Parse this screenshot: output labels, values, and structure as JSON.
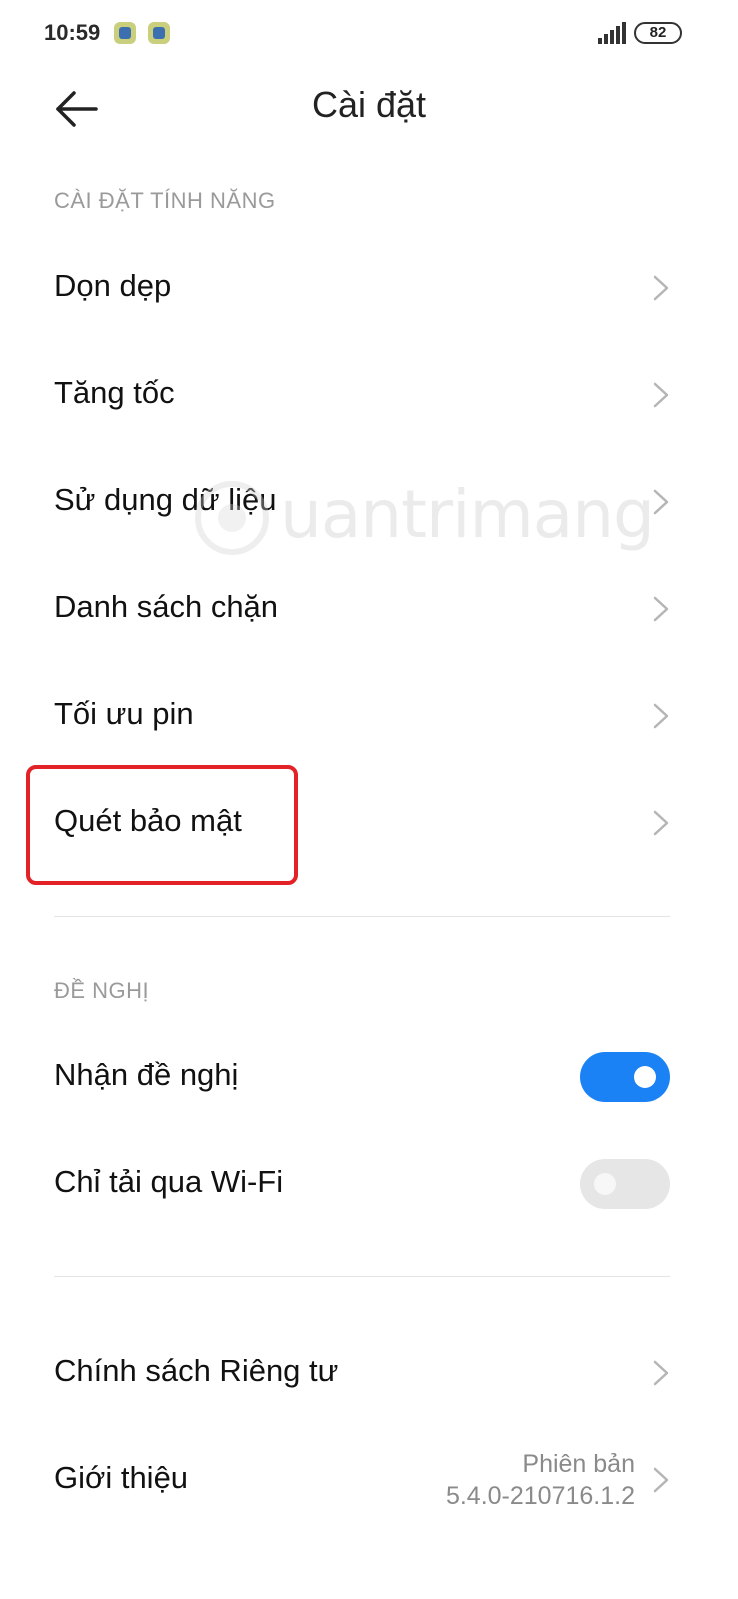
{
  "status": {
    "time": "10:59",
    "battery": "82",
    "icons": [
      "notification-app-icon",
      "notification-app-icon",
      "signal-icon",
      "battery-icon"
    ]
  },
  "header": {
    "title": "Cài đặt",
    "back_icon": "arrow-left-icon"
  },
  "sections": {
    "features": {
      "title": "CÀI ĐẶT TÍNH NĂNG",
      "items": [
        {
          "label": "Dọn dẹp"
        },
        {
          "label": "Tăng tốc"
        },
        {
          "label": "Sử dụng dữ liệu"
        },
        {
          "label": "Danh sách chặn"
        },
        {
          "label": "Tối ưu pin"
        },
        {
          "label": "Quét bảo mật"
        }
      ]
    },
    "suggestions": {
      "title": "ĐỀ NGHỊ",
      "toggles": [
        {
          "label": "Nhận đề nghị",
          "on": true
        },
        {
          "label": "Chỉ tải qua Wi-Fi",
          "on": false
        }
      ]
    },
    "about": {
      "items": [
        {
          "label": "Chính sách Riêng tư"
        },
        {
          "label": "Giới thiệu",
          "version_line1": "Phiên bản",
          "version_line2": "5.4.0-210716.1.2"
        }
      ]
    }
  },
  "watermark": "uantrimang",
  "colors": {
    "accent": "#1a82f5",
    "highlight": "#e32227",
    "section_header": "#9a9a9a"
  }
}
